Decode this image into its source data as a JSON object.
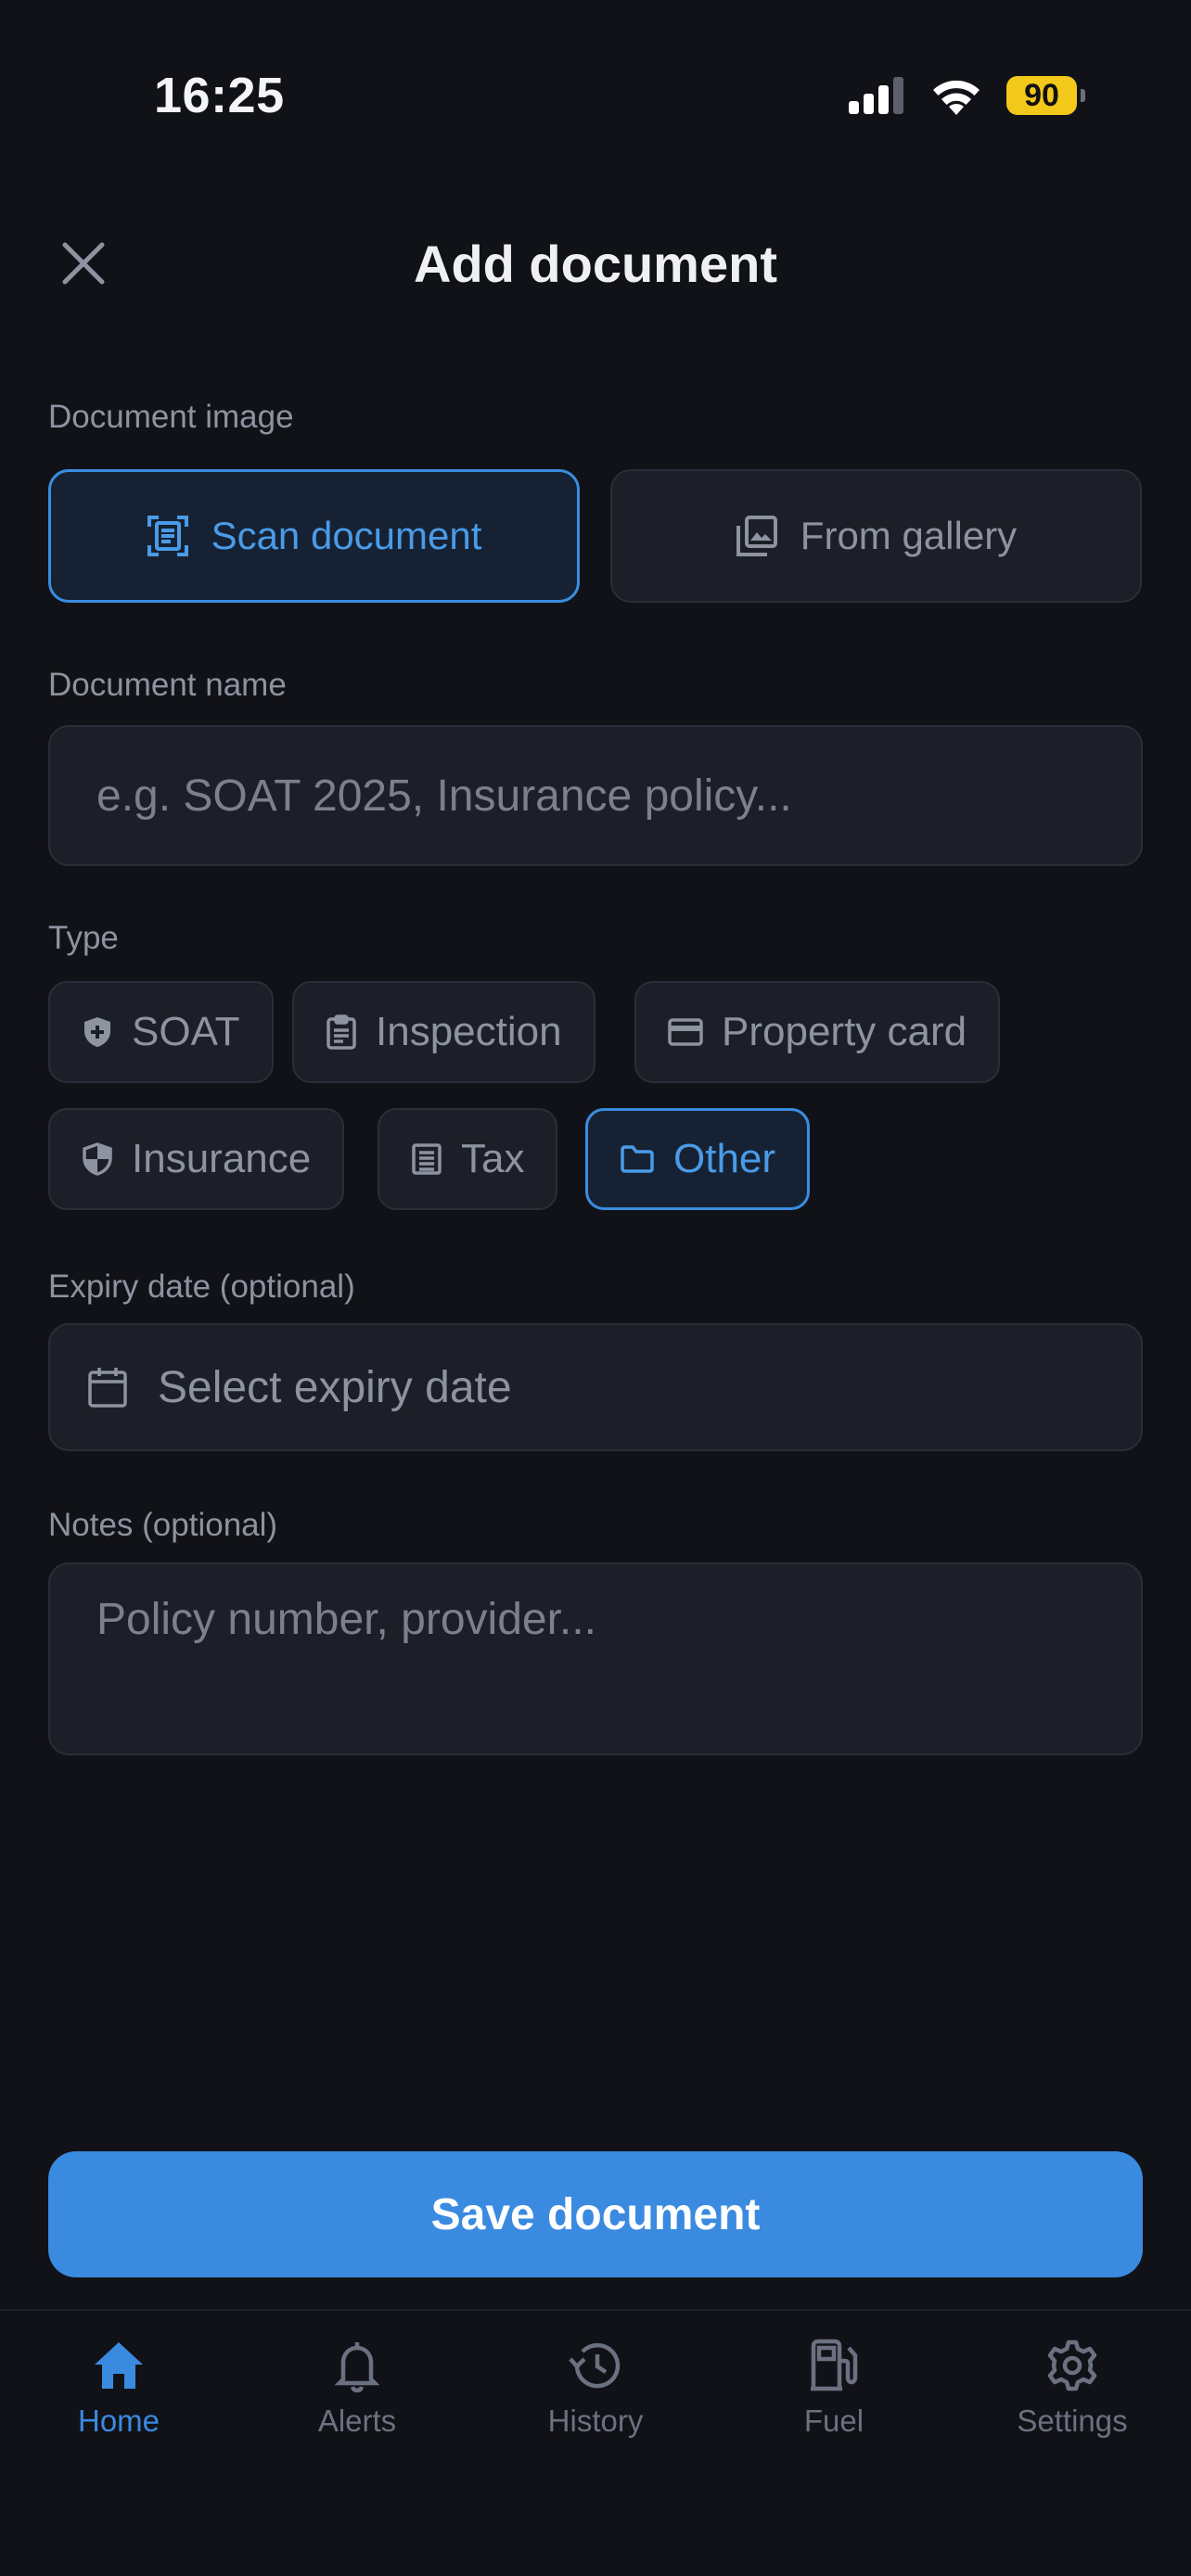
{
  "status_bar": {
    "time": "16:25",
    "battery": "90"
  },
  "header": {
    "title": "Add document"
  },
  "document_image": {
    "label": "Document image",
    "scan_label": "Scan document",
    "gallery_label": "From gallery"
  },
  "document_name": {
    "label": "Document name",
    "value": "",
    "placeholder": "e.g. SOAT 2025, Insurance policy..."
  },
  "type": {
    "label": "Type",
    "selected": "Other",
    "options": [
      {
        "label": "SOAT",
        "icon": "shield-plus-icon"
      },
      {
        "label": "Inspection",
        "icon": "clipboard-icon"
      },
      {
        "label": "Property card",
        "icon": "card-icon"
      },
      {
        "label": "Insurance",
        "icon": "shield-icon"
      },
      {
        "label": "Tax",
        "icon": "receipt-icon"
      },
      {
        "label": "Other",
        "icon": "folder-icon"
      }
    ]
  },
  "expiry": {
    "label": "Expiry date (optional)",
    "placeholder": "Select expiry date"
  },
  "notes": {
    "label": "Notes (optional)",
    "value": "",
    "placeholder": "Policy number, provider..."
  },
  "save_label": "Save document",
  "tabbar": {
    "active": "Home",
    "items": [
      {
        "label": "Home",
        "icon": "home-icon"
      },
      {
        "label": "Alerts",
        "icon": "bell-icon"
      },
      {
        "label": "History",
        "icon": "history-icon"
      },
      {
        "label": "Fuel",
        "icon": "fuel-icon"
      },
      {
        "label": "Settings",
        "icon": "gear-icon"
      }
    ]
  },
  "colors": {
    "background": "#111217",
    "accent": "#3a8ae0",
    "surface": "#1c1f27",
    "muted_text": "#8d93a0",
    "battery": "#f2c81b"
  }
}
